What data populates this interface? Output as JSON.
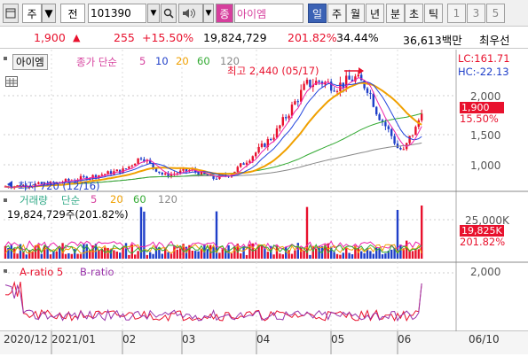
{
  "toolbar": {
    "type_label": "주",
    "price_label": "전",
    "code": "101390",
    "search_icon": "search-icon",
    "name_prefix": "종",
    "stock_name": "아이엠",
    "periods": [
      "일",
      "주",
      "월",
      "년",
      "분",
      "초",
      "틱",
      "1",
      "3",
      "5"
    ],
    "active_period": "일"
  },
  "quote": {
    "price": "1,900",
    "change": "255",
    "change_pct": "+15.50%",
    "volume": "19,824,729",
    "volume_ratio": "201.82%",
    "turnover": "34.44%",
    "amount": "36,613백만",
    "best_bid": "최우선"
  },
  "panel_price": {
    "stock_label": "아이엠",
    "legend_prefix": "종가 단순",
    "ma": [
      "5",
      "10",
      "20",
      "60",
      "120"
    ],
    "high_note": "최고 2,440 (05/17)",
    "low_note": "최저 720 (12/16)",
    "lc": "LC:161.71",
    "hc": "HC:-22.13",
    "price_tag": "1,900",
    "pct_tag": "15.50%",
    "yticks": [
      "2,000",
      "1,500",
      "1,000"
    ]
  },
  "panel_volume": {
    "title": "거래량",
    "legend_prefix": "단순",
    "ma": [
      "5",
      "20",
      "60",
      "120"
    ],
    "volume_text": "19,824,729주(201.82%)",
    "ytick": "25,000K",
    "vol_tag": "19,825K",
    "pct_tag": "201.82%"
  },
  "panel_ratio": {
    "a_label": "A-ratio 5",
    "b_label": "B-ratio",
    "ytick": "2,000"
  },
  "xaxis": {
    "labels": [
      "2020/12",
      "2021/01",
      "02",
      "03",
      "04",
      "05",
      "06"
    ],
    "last_date": "06/10"
  },
  "chart_data": {
    "type": "line",
    "note": "daily candlestick price (close values approx)",
    "x": [
      "2020/12",
      "2021/01",
      "02",
      "03",
      "04",
      "05",
      "06/10"
    ],
    "series": [
      {
        "name": "종가",
        "values": [
          750,
          790,
          1150,
          900,
          1250,
          2200,
          1900
        ]
      }
    ],
    "ylim": [
      700,
      2450
    ],
    "colors": {
      "up": "#e8112d",
      "down": "#1f3fc9",
      "ma5": "#ee22aa",
      "ma10": "#2244dd",
      "ma20": "#f0a000",
      "ma60": "#33aa33",
      "ma120": "#888888"
    }
  }
}
